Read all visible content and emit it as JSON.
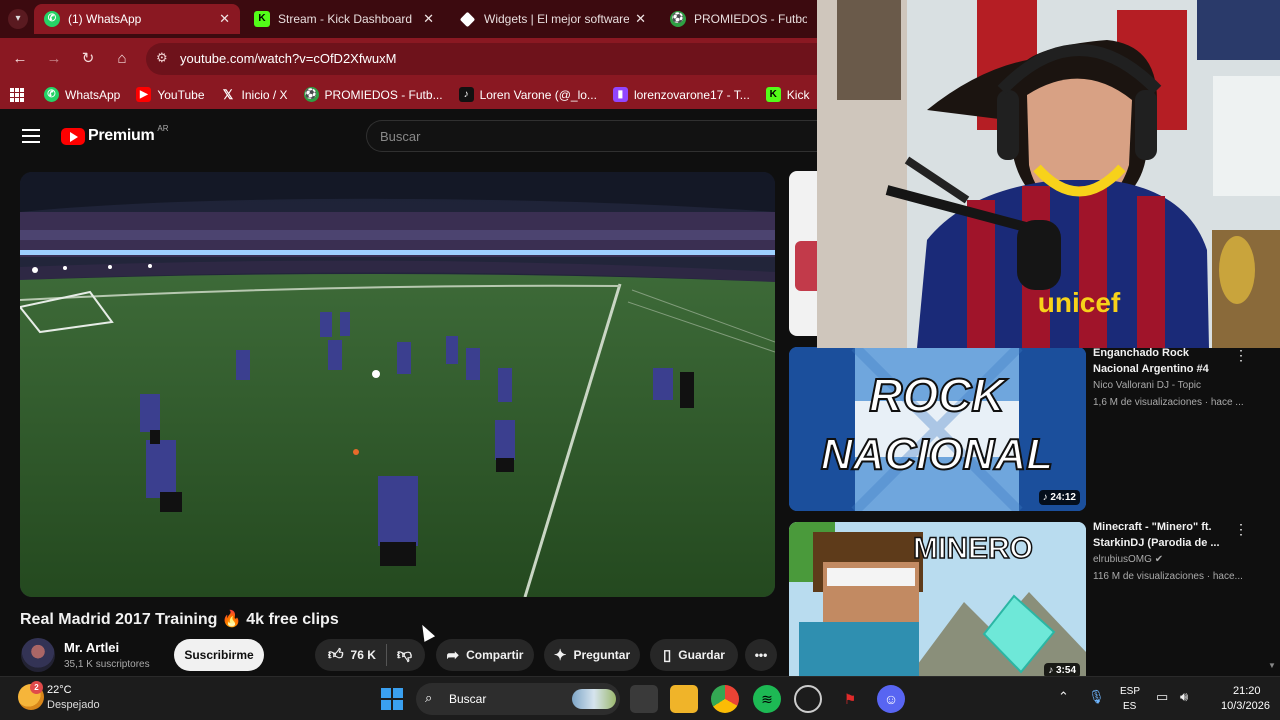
{
  "browser": {
    "tabs": [
      {
        "label": "(1) WhatsApp",
        "icon": "whatsapp-icon",
        "color": "#25d366"
      },
      {
        "label": "Stream - Kick Dashboard",
        "icon": "kick-icon",
        "color": "#53fc18"
      },
      {
        "label": "Widgets | El mejor software",
        "icon": "widgets-icon",
        "color": "#ffffff"
      },
      {
        "label": "PROMIEDOS - Futbol Arg",
        "icon": "promiedos-icon",
        "color": "#2ea043"
      }
    ],
    "url": "youtube.com/watch?v=cOfD2XfwuxM",
    "bookmarks": [
      {
        "label": "WhatsApp",
        "icon": "whatsapp-icon",
        "color": "#25d366"
      },
      {
        "label": "YouTube",
        "icon": "youtube-icon",
        "color": "#ff0000"
      },
      {
        "label": "Inicio / X",
        "icon": "x-icon",
        "color": "#000000"
      },
      {
        "label": "PROMIEDOS - Futb...",
        "icon": "promiedos-icon",
        "color": "#2ea043"
      },
      {
        "label": "Loren Varone (@_lo...",
        "icon": "tiktok-icon",
        "color": "#111111"
      },
      {
        "label": "lorenzovarone17 - T...",
        "icon": "twitch-icon",
        "color": "#9146ff"
      },
      {
        "label": "Kick",
        "icon": "kick-icon",
        "color": "#53fc18"
      }
    ]
  },
  "youtube": {
    "logo_text": "Premium",
    "country_code": "AR",
    "search_placeholder": "Buscar",
    "video": {
      "title": "Real Madrid 2017 Training 🔥 4k free clips",
      "channel": "Mr. Artlei",
      "subscribers": "35,1 K suscriptores",
      "subscribe_label": "Suscribirme",
      "likes": "76 K",
      "share_label": "Compartir",
      "ask_label": "Preguntar",
      "save_label": "Guardar"
    },
    "recommendations": [
      {
        "title": "Enganchado Rock Nacional Argentino #4",
        "channel": "Nico Vallorani DJ - Topic",
        "meta": "1,6 M de visualizaciones · hace ...",
        "duration": "24:12",
        "thumb_text_1": "ROCK",
        "thumb_text_2": "NACIONAL"
      },
      {
        "title": "Minecraft - \"Minero\" ft. StarkinDJ (Parodia de ...",
        "channel": "elrubiusOMG",
        "meta": "116 M de visualizaciones · hace...",
        "duration": "3:54",
        "thumb_text": "MINERO"
      }
    ]
  },
  "taskbar": {
    "temperature": "22°C",
    "condition": "Despejado",
    "weather_badge": "2",
    "search_label": "Buscar",
    "language_1": "ESP",
    "language_2": "ES",
    "time": "21:20",
    "date": "10/3/2026"
  },
  "webcam": {
    "jersey_text": "unicef"
  }
}
